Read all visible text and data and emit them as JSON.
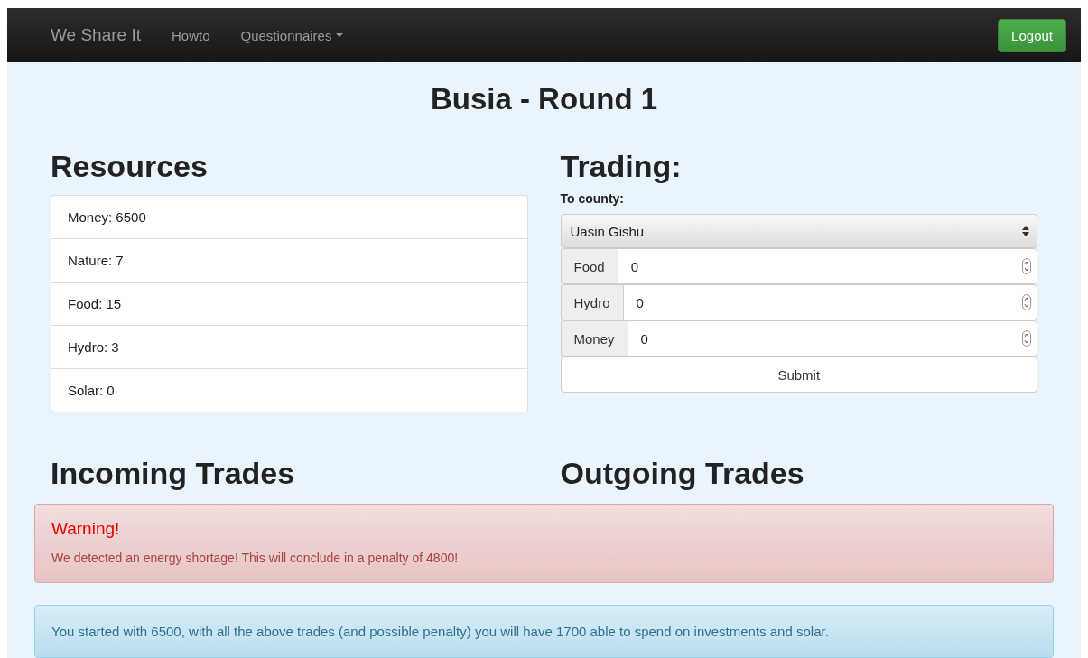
{
  "navbar": {
    "brand": "We Share It",
    "links": [
      {
        "label": "Howto",
        "kind": "link"
      },
      {
        "label": "Questionnaires",
        "kind": "dropdown"
      }
    ],
    "logout": "Logout"
  },
  "title": "Busia - Round 1",
  "resources": {
    "heading": "Resources",
    "items": [
      "Money: 6500",
      "Nature: 7",
      "Food: 15",
      "Hydro: 3",
      "Solar: 0"
    ]
  },
  "trading": {
    "heading": "Trading:",
    "county_label": "To county:",
    "county": "Uasin Gishu",
    "fields": [
      {
        "label": "Food",
        "value": "0"
      },
      {
        "label": "Hydro",
        "value": "0"
      },
      {
        "label": "Money",
        "value": "0"
      }
    ],
    "submit": "Submit"
  },
  "incoming_heading": "Incoming Trades",
  "outgoing_heading": "Outgoing Trades",
  "warning": {
    "title": "Warning!",
    "message": "We detected an energy shortage! This will conclude in a penalty of 4800!"
  },
  "info": "You started with 6500, with all the above trades (and possible penalty) you will have 1700 able to spend on investments and solar."
}
